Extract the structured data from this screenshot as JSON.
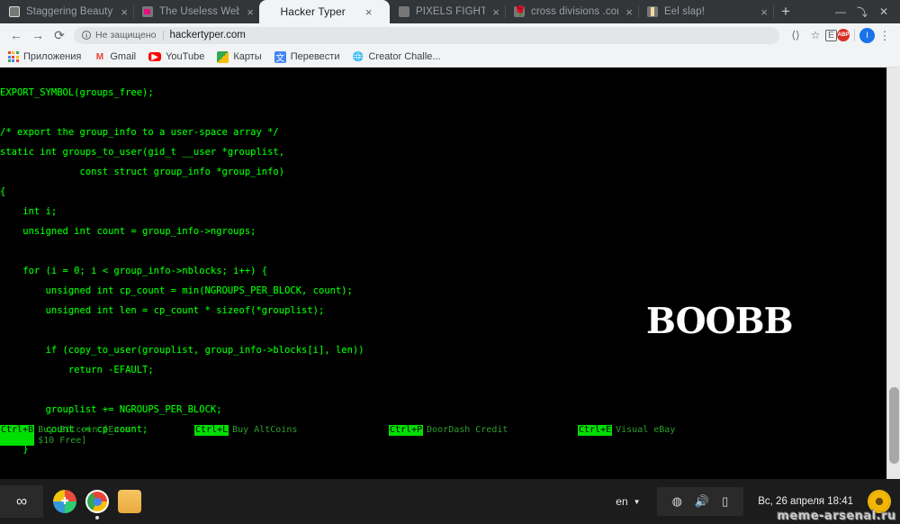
{
  "browser": {
    "tabs": [
      {
        "title": "Staggering Beauty",
        "favicon": "white-square-icon",
        "active": false
      },
      {
        "title": "The Useless Web",
        "favicon": "pink-square-icon",
        "active": false
      },
      {
        "title": "Hacker Typer",
        "favicon": "none",
        "active": true
      },
      {
        "title": "PIXELS FIGHTING",
        "favicon": "grey-circle-icon",
        "active": false
      },
      {
        "title": "cross divisions .coм",
        "favicon": "rose-icon",
        "active": false
      },
      {
        "title": "Eel slap!",
        "favicon": "eel-icon",
        "active": false
      }
    ],
    "tab_close_label": "×",
    "new_tab_label": "+",
    "window_controls": {
      "minimize": "—",
      "restore": "⤵",
      "close": "✕"
    },
    "nav": {
      "back": "←",
      "forward": "→",
      "reload": "⟳"
    },
    "omnibox": {
      "security_icon": "info-icon",
      "security_label": "Не защищено",
      "url": "hackertyper.com"
    },
    "toolbar_icons": [
      {
        "name": "translate-icon",
        "glyph": "⟨⟩"
      },
      {
        "name": "bookmark-star-icon",
        "glyph": "☆"
      },
      {
        "name": "extension-e-icon",
        "glyph": "E"
      },
      {
        "name": "extension-adblock-icon",
        "glyph": "ABP"
      }
    ],
    "profile_initial": "I",
    "menu_glyph": "⋮",
    "bookmarks": [
      {
        "label": "Приложения",
        "icon": "apps-grid-icon"
      },
      {
        "label": "Gmail",
        "icon": "gmail-icon"
      },
      {
        "label": "YouTube",
        "icon": "youtube-icon"
      },
      {
        "label": "Карты",
        "icon": "maps-icon"
      },
      {
        "label": "Перевести",
        "icon": "translate-icon"
      },
      {
        "label": "Creator Challe...",
        "icon": "globe-icon"
      }
    ]
  },
  "page": {
    "accent_color": "#00ff00",
    "background_color": "#000000",
    "code_lines": [
      "EXPORT_SYMBOL(groups_free);",
      "",
      "/* export the group_info to a user-space array */",
      "static int groups_to_user(gid_t __user *grouplist,",
      "              const struct group_info *group_info)",
      "{",
      "    int i;",
      "    unsigned int count = group_info->ngroups;",
      "",
      "    for (i = 0; i < group_info->nblocks; i++) {",
      "        unsigned int cp_count = min(NGROUPS_PER_BLOCK, count);",
      "        unsigned int len = cp_count * sizeof(*grouplist);",
      "",
      "        if (copy_to_user(grouplist, group_info->blocks[i], len))",
      "            return -EFAULT;",
      "",
      "        grouplist += NGROUPS_PER_BLOCK;",
      "        count -= cp_count;",
      "    }"
    ],
    "watermark_text": "Boobb",
    "ads": [
      {
        "key": "Ctrl+B",
        "text": "Buy Bitcoin [Earn $10 Free]"
      },
      {
        "key": "Ctrl+L",
        "text": "Buy AltCoins"
      },
      {
        "key": "Ctrl+P",
        "text": "DoorDash Credit"
      },
      {
        "key": "Ctrl+E",
        "text": "Visual eBay"
      }
    ]
  },
  "taskbar": {
    "show_desktop_icon": "infinity-icon",
    "apps": [
      {
        "name": "photos-app-icon",
        "glyph": "➕"
      },
      {
        "name": "chrome-app-icon",
        "glyph": ""
      },
      {
        "name": "files-folder-icon",
        "glyph": ""
      }
    ],
    "language": "en",
    "language_caret": "▼",
    "tray": [
      {
        "name": "wifi-icon",
        "glyph": "◴"
      },
      {
        "name": "volume-icon",
        "glyph": "🔊"
      },
      {
        "name": "battery-icon",
        "glyph": "⬜"
      }
    ],
    "clock": "Вс, 26 апреля  18:41",
    "tray_flower_icon": "sunflower-icon"
  },
  "watermark": {
    "site": "meme-arsenal.ru"
  }
}
